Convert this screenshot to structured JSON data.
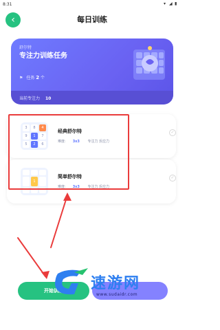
{
  "status_bar": {
    "time": "8:31"
  },
  "header": {
    "back_icon": "chevron-left-icon",
    "title": "每日训练"
  },
  "task_card": {
    "tag": "舒尔特",
    "title": "专注力训练任务",
    "tasks_label": "任务",
    "tasks_count": "2",
    "tasks_unit": "个",
    "focus_label": "当前专注力",
    "focus_value": "10",
    "illustration_icon": "brain-puzzle-icon",
    "color_start": "#6f7bff",
    "color_end": "#5b54e8"
  },
  "games": [
    {
      "title": "经典舒尔特",
      "difficulty_label": "难度:",
      "difficulty_value": "3x3",
      "tags": "专注力 反应力",
      "grid": [
        "3",
        "8",
        "4",
        "9",
        "1",
        "7",
        "5",
        "2",
        "6"
      ]
    },
    {
      "title": "简单舒尔特",
      "difficulty_label": "难度:",
      "difficulty_value": "3x3",
      "tags": "专注力 反应力",
      "grid": [
        "",
        "",
        "",
        "",
        "1",
        "",
        "",
        "",
        ""
      ]
    }
  ],
  "buttons": {
    "start": "开始训练"
  },
  "watermark": {
    "brand": "速游网",
    "url": "www.sudaidr.com"
  },
  "colors": {
    "accent_green": "#26c281",
    "highlight_red": "#ea3b3b",
    "purple": "#6a62f2"
  }
}
